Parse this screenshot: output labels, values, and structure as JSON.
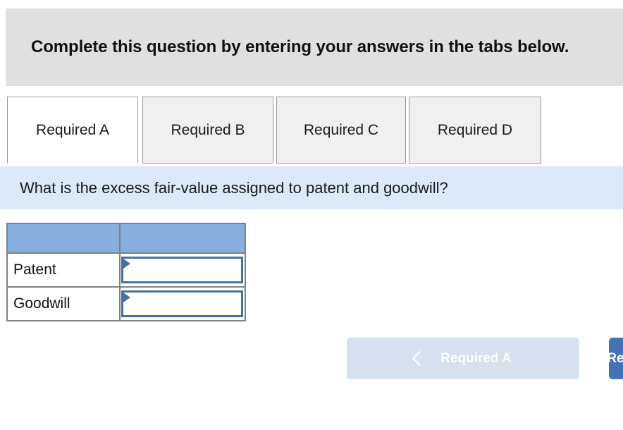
{
  "instruction": {
    "text": "Complete this question by entering your answers in the tabs below."
  },
  "tabs": [
    {
      "label": "Required A",
      "active": true
    },
    {
      "label": "Required B",
      "active": false
    },
    {
      "label": "Required C",
      "active": false
    },
    {
      "label": "Required D",
      "active": false
    }
  ],
  "question": {
    "text": "What is the excess fair-value assigned to patent and goodwill?"
  },
  "answer_table": {
    "headers": [
      "",
      ""
    ],
    "rows": [
      {
        "label": "Patent",
        "value": ""
      },
      {
        "label": "Goodwill",
        "value": ""
      }
    ]
  },
  "navigation": {
    "prev_label": "Required A",
    "prev_icon": "chevron-left-icon",
    "next_label": "Required B",
    "next_icon": "chevron-right-icon"
  },
  "colors": {
    "banner_gray": "#e0e0e0",
    "question_blue": "#dbe9f8",
    "table_header_blue": "#86aede",
    "input_border_blue": "#4472a8",
    "button_disabled": "#d6e0ee",
    "button_active": "#4272b8",
    "tab_inactive": "#f0f0f0"
  }
}
